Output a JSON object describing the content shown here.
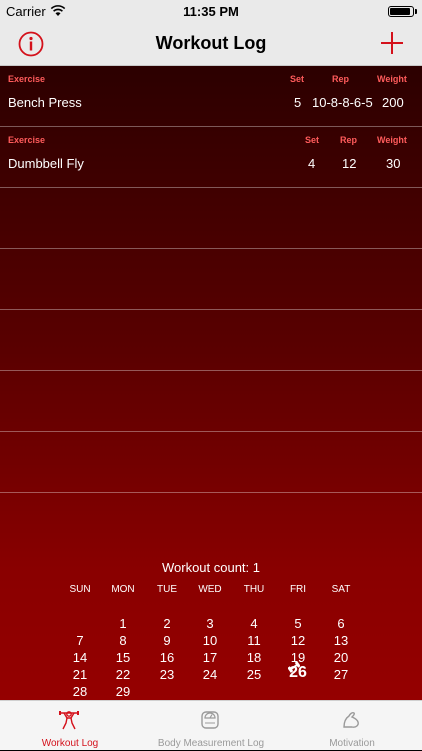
{
  "status": {
    "carrier": "Carrier",
    "time": "11:35 PM"
  },
  "nav": {
    "title": "Workout Log"
  },
  "entries": [
    {
      "h_exercise": "Exercise",
      "h_set": "Set",
      "h_rep": "Rep",
      "h_weight": "Weight",
      "exercise": "Bench Press",
      "set": "5",
      "rep": "10-8-8-6-5",
      "weight": "200"
    },
    {
      "h_exercise": "Exercise",
      "h_set": "Set",
      "h_rep": "Rep",
      "h_weight": "Weight",
      "exercise": "Dumbbell Fly",
      "set": "4",
      "rep": "12",
      "weight": "30"
    }
  ],
  "calendar": {
    "count_label": "Workout count: 1",
    "weekdays": [
      "SUN",
      "MON",
      "TUE",
      "WED",
      "THU",
      "FRI",
      "SAT"
    ],
    "days": [
      "1",
      "2",
      "3",
      "4",
      "5",
      "6",
      "7",
      "8",
      "9",
      "10",
      "11",
      "12",
      "13",
      "14",
      "15",
      "16",
      "17",
      "18",
      "19",
      "20",
      "21",
      "22",
      "23",
      "24",
      "25",
      "26",
      "27",
      "28",
      "29"
    ],
    "today": "26"
  },
  "tabs": [
    {
      "label": "Workout Log",
      "icon": "weightlifter-icon"
    },
    {
      "label": "Body Measurement Log",
      "icon": "scale-icon"
    },
    {
      "label": "Motivation",
      "icon": "flexed-arm-icon"
    }
  ],
  "colors": {
    "accent": "#d4111b",
    "header_text": "#ff5b5b"
  }
}
